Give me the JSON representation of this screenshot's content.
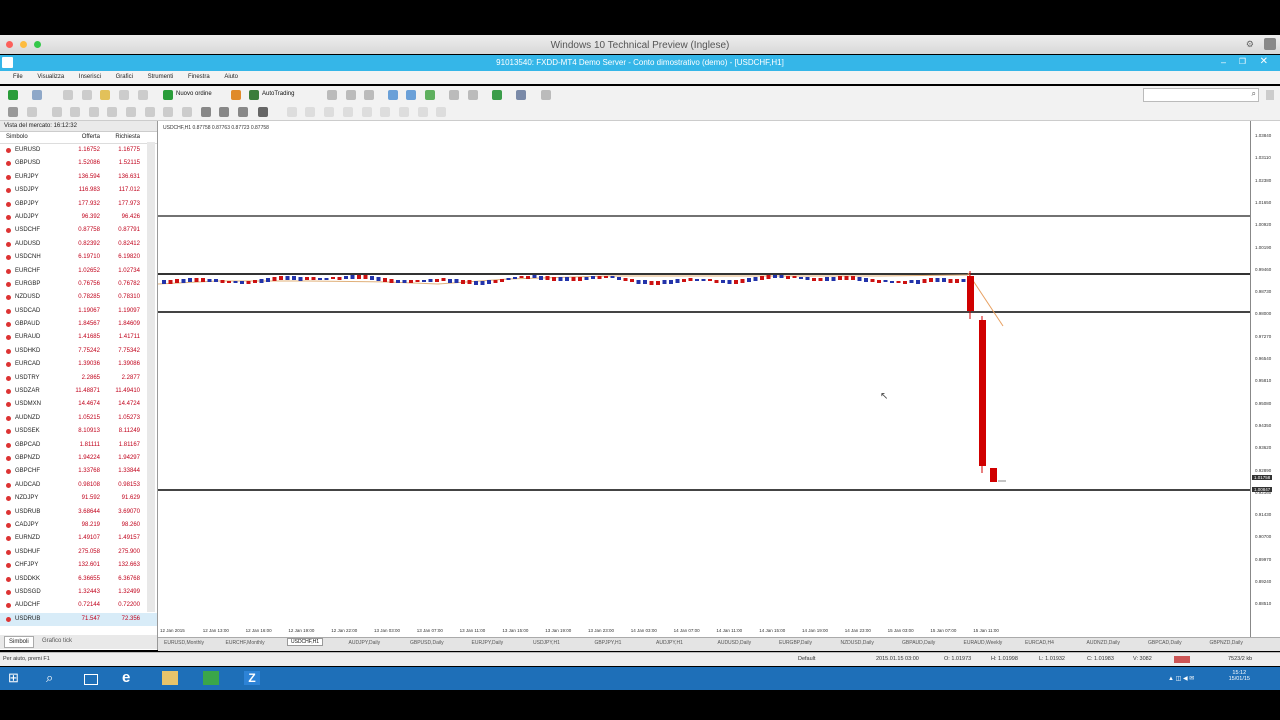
{
  "mac_title": "Windows 10 Technical Preview (Inglese)",
  "app_title": "91013540: FXDD-MT4 Demo Server - Conto dimostrativo (demo) - [USDCHF,H1]",
  "menu": [
    "File",
    "Visualizza",
    "Inserisci",
    "Grafici",
    "Strumenti",
    "Finestra",
    "Aiuto"
  ],
  "toolbar": {
    "new_order": "Nuovo ordine",
    "autotrading": "AutoTrading"
  },
  "market_watch": {
    "title": "Vista del mercato: 16:12:32",
    "headers": {
      "symbol": "Simbolo",
      "bid": "Offerta",
      "ask": "Richiesta"
    },
    "rows": [
      {
        "sym": "EURUSD",
        "bid": "1.16752",
        "ask": "1.16775"
      },
      {
        "sym": "GBPUSD",
        "bid": "1.52086",
        "ask": "1.52115"
      },
      {
        "sym": "EURJPY",
        "bid": "136.594",
        "ask": "136.631"
      },
      {
        "sym": "USDJPY",
        "bid": "116.983",
        "ask": "117.012"
      },
      {
        "sym": "GBPJPY",
        "bid": "177.932",
        "ask": "177.973"
      },
      {
        "sym": "AUDJPY",
        "bid": "96.392",
        "ask": "96.426"
      },
      {
        "sym": "USDCHF",
        "bid": "0.87758",
        "ask": "0.87791"
      },
      {
        "sym": "AUDUSD",
        "bid": "0.82392",
        "ask": "0.82412"
      },
      {
        "sym": "USDCNH",
        "bid": "6.19710",
        "ask": "6.19820"
      },
      {
        "sym": "EURCHF",
        "bid": "1.02652",
        "ask": "1.02734"
      },
      {
        "sym": "EURGBP",
        "bid": "0.76756",
        "ask": "0.76782"
      },
      {
        "sym": "NZDUSD",
        "bid": "0.78285",
        "ask": "0.78310"
      },
      {
        "sym": "USDCAD",
        "bid": "1.19067",
        "ask": "1.19097"
      },
      {
        "sym": "GBPAUD",
        "bid": "1.84567",
        "ask": "1.84609"
      },
      {
        "sym": "EURAUD",
        "bid": "1.41685",
        "ask": "1.41711"
      },
      {
        "sym": "USDHKD",
        "bid": "7.75242",
        "ask": "7.75342"
      },
      {
        "sym": "EURCAD",
        "bid": "1.39036",
        "ask": "1.39086"
      },
      {
        "sym": "USDTRY",
        "bid": "2.2865",
        "ask": "2.2877"
      },
      {
        "sym": "USDZAR",
        "bid": "11.48871",
        "ask": "11.49410"
      },
      {
        "sym": "USDMXN",
        "bid": "14.4674",
        "ask": "14.4724"
      },
      {
        "sym": "AUDNZD",
        "bid": "1.05215",
        "ask": "1.05273"
      },
      {
        "sym": "USDSEK",
        "bid": "8.10913",
        "ask": "8.11249"
      },
      {
        "sym": "GBPCAD",
        "bid": "1.81111",
        "ask": "1.81167"
      },
      {
        "sym": "GBPNZD",
        "bid": "1.94224",
        "ask": "1.94297"
      },
      {
        "sym": "GBPCHF",
        "bid": "1.33768",
        "ask": "1.33844"
      },
      {
        "sym": "AUDCAD",
        "bid": "0.98108",
        "ask": "0.98153"
      },
      {
        "sym": "NZDJPY",
        "bid": "91.592",
        "ask": "91.629"
      },
      {
        "sym": "USDRUB",
        "bid": "3.68644",
        "ask": "3.69070"
      },
      {
        "sym": "CADJPY",
        "bid": "98.219",
        "ask": "98.260"
      },
      {
        "sym": "EURNZD",
        "bid": "1.49107",
        "ask": "1.49157"
      },
      {
        "sym": "USDHUF",
        "bid": "275.058",
        "ask": "275.900"
      },
      {
        "sym": "CHFJPY",
        "bid": "132.601",
        "ask": "132.663"
      },
      {
        "sym": "USDDKK",
        "bid": "6.36655",
        "ask": "6.36768"
      },
      {
        "sym": "USDSGD",
        "bid": "1.32443",
        "ask": "1.32499"
      },
      {
        "sym": "AUDCHF",
        "bid": "0.72144",
        "ask": "0.72200"
      },
      {
        "sym": "USDRUB",
        "bid": "71.547",
        "ask": "72.356"
      }
    ],
    "tabs": [
      "Simboli",
      "Grafico tick"
    ]
  },
  "chart": {
    "info": "USDCHF,H1 0.87758 0.87763 0.87723 0.87758",
    "y_labels": [
      "1.03840",
      "1.03110",
      "1.02380",
      "1.01650",
      "1.00920",
      "1.00190",
      "0.99460",
      "0.98730",
      "0.98000",
      "0.97270",
      "0.96540",
      "0.95810",
      "0.95080",
      "0.94350",
      "0.93620",
      "0.92890",
      "0.92160",
      "0.91430",
      "0.90700",
      "0.89970",
      "0.89240",
      "0.88510"
    ],
    "current_prices": [
      "1.01758",
      "1.00847"
    ],
    "x_labels": [
      "12 Jan 2015",
      "12 Jan 13:00",
      "12 Jan 16:00",
      "12 Jan 19:00",
      "12 Jan 22:00",
      "13 Jan 03:00",
      "13 Jan 07:00",
      "13 Jan 11:00",
      "13 Jan 15:00",
      "13 Jan 19:00",
      "13 Jan 23:00",
      "14 Jan 03:00",
      "14 Jan 07:00",
      "14 Jan 11:00",
      "14 Jan 15:00",
      "14 Jan 19:00",
      "14 Jan 23:00",
      "15 Jan 03:00",
      "15 Jan 07:00",
      "15 Jan 11:00"
    ]
  },
  "chart_tabs": [
    "EURUSD,Monthly",
    "EURCHF,Monthly",
    "USDCHF,H1",
    "AUDJPY,Daily",
    "GBPUSD,Daily",
    "EURJPY,Daily",
    "USDJPY,H1",
    "GBPJPY,H1",
    "AUDJPY,H1",
    "AUDUSD,Daily",
    "EURGBP,Daily",
    "NZDUSD,Daily",
    "GBPAUD,Daily",
    "EURAUD,Weekly",
    "EURCAD,H4",
    "AUDNZD,Daily",
    "GBPCAD,Daily",
    "GBPNZD,Daily"
  ],
  "status": {
    "help": "Per aiuto, premi F1",
    "profile": "Default",
    "datetime": "2015.01.15 03:00",
    "open": "O: 1.01973",
    "high": "H: 1.01998",
    "low": "L: 1.01932",
    "close": "C: 1.01983",
    "volume": "V: 3082",
    "traffic": "7523/2 kb"
  },
  "clock": {
    "time": "15:12",
    "date": "15/01/15"
  }
}
